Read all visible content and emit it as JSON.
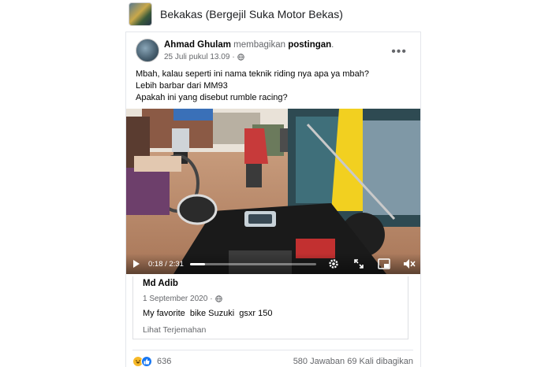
{
  "group": {
    "name": "Bekakas (Bergejil Suka Motor Bekas)"
  },
  "post": {
    "author": "Ahmad Ghulam",
    "action": " membagikan ",
    "target": "postingan",
    "target_suffix": ".",
    "timestamp": "25 Juli pukul 13.09",
    "separator": " · ",
    "text_lines": [
      "Mbah, kalau seperti ini nama teknik riding nya apa ya mbah?",
      "Lebih barbar dari MM93",
      "Apakah ini yang disebut rumble racing?"
    ]
  },
  "video": {
    "time": "0:18 / 2:31",
    "progress": 0.12
  },
  "shared": {
    "author": "Md Adib",
    "date": "1 September 2020",
    "separator": " · ",
    "text": "My favorite  bike Suzuki  gsxr 150",
    "translate_label": "Lihat Terjemahan"
  },
  "footer": {
    "reaction_count": "636",
    "comments": "580 Jawaban",
    "shares": "69 Kali dibagikan"
  },
  "icons": {
    "more": "more-horizontal-icon",
    "globe": "globe-icon",
    "play": "play-icon",
    "settings": "gear-icon",
    "fullscreen": "expand-icon",
    "pip": "picture-in-picture-icon",
    "volume": "volume-icon",
    "haha": "haha-reaction-icon",
    "like": "like-reaction-icon"
  },
  "colors": {
    "link_blue": "#1877f2",
    "secondary_text": "#65676b",
    "haha_yellow": "#f7b928"
  }
}
